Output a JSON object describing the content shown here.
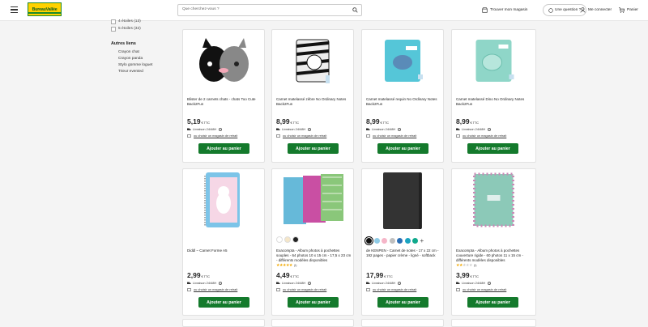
{
  "header": {
    "logo_text": "BureauVallée",
    "search_placeholder": "Que cherchez-vous ?",
    "store_label": "Trouver mon magasin",
    "question_label": "Une question ?",
    "login_label": "Me connecter",
    "cart_label": "Panier",
    "brand_colors": {
      "green": "#147a2c",
      "yellow": "#ffd200"
    }
  },
  "sidebar": {
    "ratings": [
      "4 étoiles (13)",
      "5 étoiles (32)"
    ],
    "links_title": "Autres liens",
    "links": [
      "Crayon chat",
      "Crayon panda",
      "Stylo gomme loguet",
      "Trieur evented"
    ]
  },
  "common": {
    "currency": "€ TTC",
    "pickup": "ou choisir un magasin de retrait",
    "add_to_cart": "Ajouter au panier"
  },
  "products": [
    {
      "name": "Blister de 2 carnets chats - chats Too Cute Back2Fun",
      "price": "5,19",
      "delivery": "Livraison 24/48H"
    },
    {
      "name": "Carnet matelassé zèbre No Ordinary Notes Back2Fun",
      "price": "8,99",
      "delivery": "Livraison 24/48H"
    },
    {
      "name": "Carnet matelassé requin No Ordinary Notes Back2Fun",
      "price": "8,99",
      "delivery": "Livraison 24/48H"
    },
    {
      "name": "Carnet matelassé Dino No Ordinary Notes Back2Fun",
      "price": "8,99",
      "delivery": "Livraison 24/48H"
    },
    {
      "name": "Diddl – Carnet Forme A5",
      "price": "2,99",
      "delivery": "Livraison 24/48H"
    },
    {
      "name": "Exacompta - Album photos à pochettes souples - 64 photos 10 x 15 cm - 17,5 x 23 cm - différents modèles disponibles",
      "price": "4,49",
      "delivery": "Livraison 24/48H",
      "rating_count": "(1)"
    },
    {
      "name": "de KENPEN - Carnet de notes - 17 x 22 cm - 192 pages - papier crème - ligné - softback",
      "price": "17,99",
      "delivery": "Livraison 24/48H"
    },
    {
      "name": "Exacompta - Album photos à pochettes couverture rigide - 60 photos 11 x 15 cm - différents modèles disponibles",
      "price": "3,99",
      "delivery": "Livraison 24/48H",
      "rating_count": "(1)"
    }
  ],
  "product_colors": [
    "#111111",
    "#8ecbe6",
    "#f5b5c8",
    "#bfbfbf",
    "#2b6fb5",
    "#1aa3c0",
    "#10a98c"
  ],
  "extra_colors_glyph": "+"
}
